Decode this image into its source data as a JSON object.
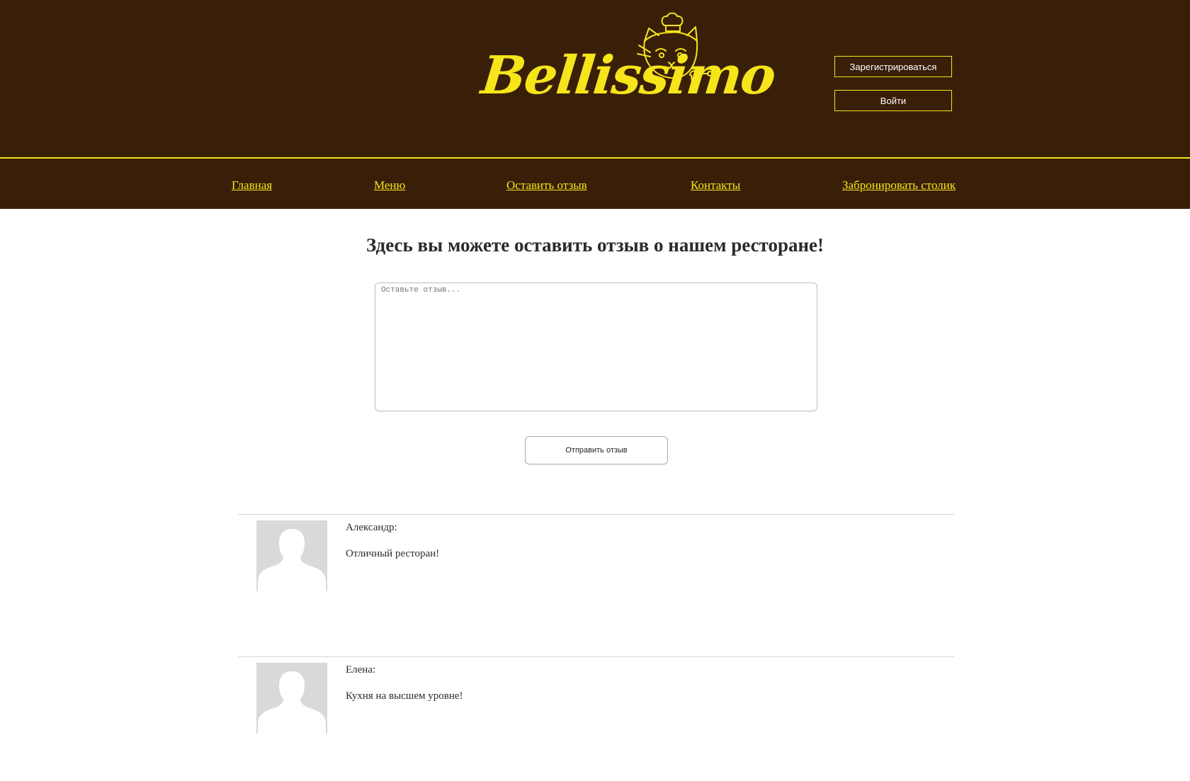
{
  "header": {
    "logo_text": "Bellissimo",
    "register_label": "Зарегистрироваться",
    "login_label": "Войти"
  },
  "nav": {
    "items": [
      {
        "label": "Главная"
      },
      {
        "label": "Меню"
      },
      {
        "label": "Оставить отзыв"
      },
      {
        "label": "Контакты"
      },
      {
        "label": "Забронировать столик"
      }
    ]
  },
  "main": {
    "title": "Здесь вы можете оставить отзыв о нашем ресторане!",
    "textarea_placeholder": "Оставьте отзыв...",
    "submit_label": "Отправить отзыв"
  },
  "reviews": [
    {
      "author": "Александр:",
      "text": "Отличный ресторан!"
    },
    {
      "author": "Елена:",
      "text": "Кухня на высшем уровне!"
    }
  ],
  "colors": {
    "header_bg": "#3a1f08",
    "accent": "#f5e51a",
    "avatar_bg": "#d9d9d9"
  }
}
